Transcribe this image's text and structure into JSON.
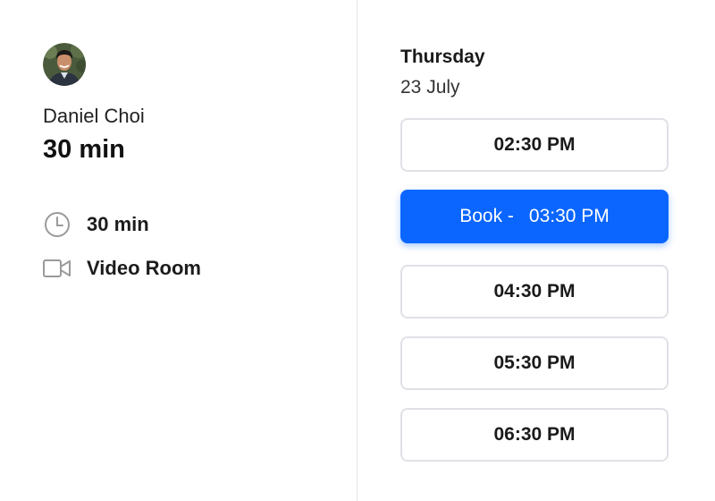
{
  "host": {
    "name": "Daniel Choi",
    "avatar_icon": "person-avatar"
  },
  "event": {
    "title": "30 min",
    "duration_label": "30 min",
    "location_label": "Video Room",
    "duration_icon": "clock-icon",
    "location_icon": "video-camera-icon"
  },
  "schedule": {
    "weekday": "Thursday",
    "date": "23 July",
    "book_prefix": "Book -",
    "slots": [
      {
        "time": "02:30 PM",
        "selected": false
      },
      {
        "time": "03:30 PM",
        "selected": true
      },
      {
        "time": "04:30 PM",
        "selected": false
      },
      {
        "time": "05:30 PM",
        "selected": false
      },
      {
        "time": "06:30 PM",
        "selected": false
      }
    ]
  },
  "colors": {
    "accent": "#0a66ff",
    "divider": "#e6e6e6",
    "slot_border": "#dfe1e6"
  }
}
